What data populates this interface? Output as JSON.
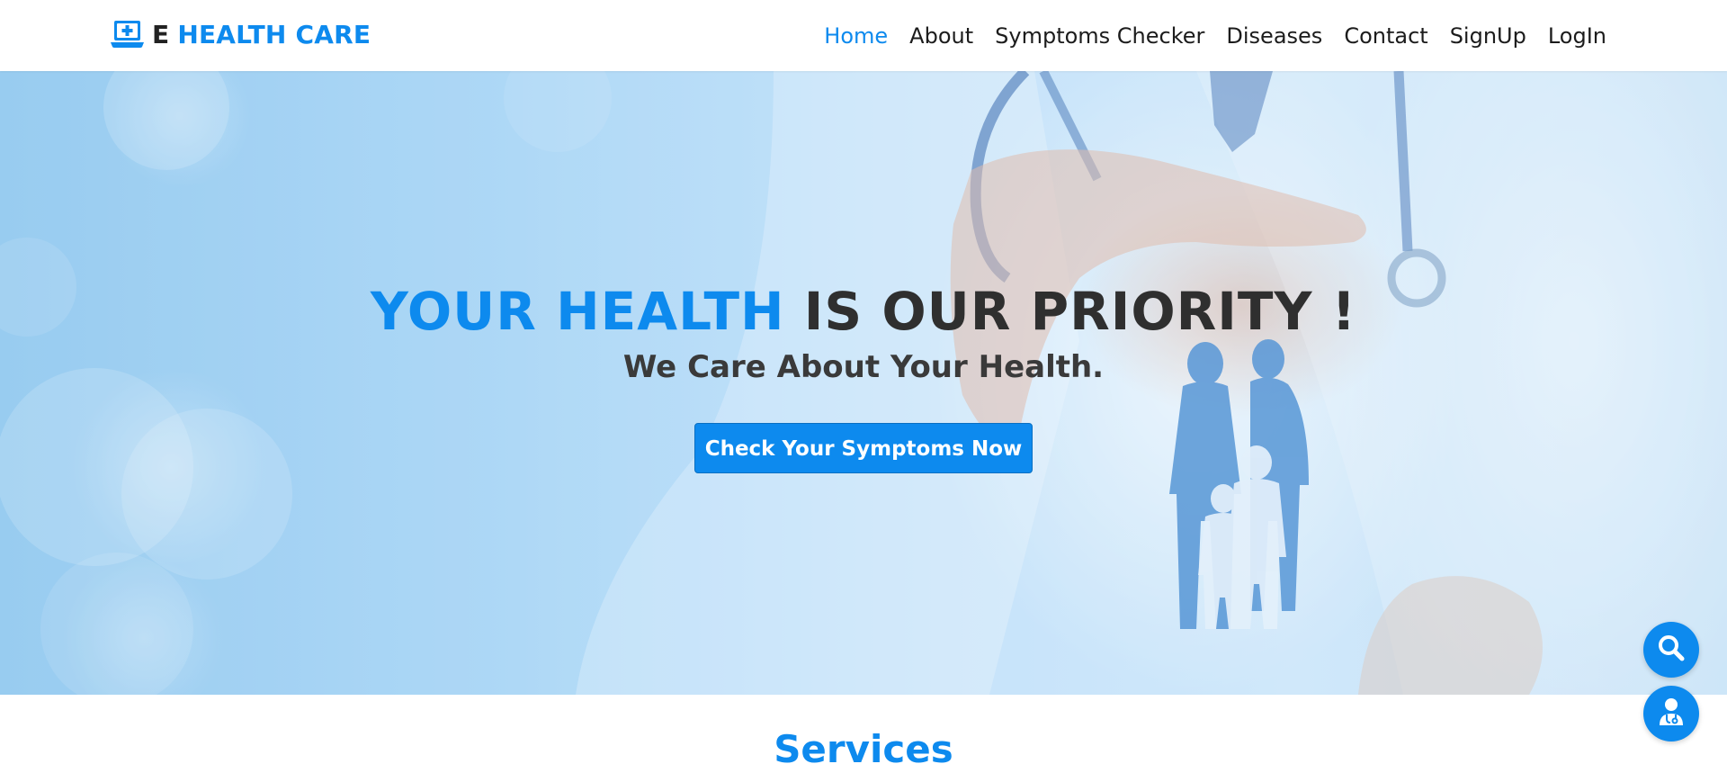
{
  "brand": {
    "prefix": "E",
    "name": "HEALTH CARE",
    "icon": "medical-laptop-icon"
  },
  "nav": {
    "items": [
      {
        "label": "Home",
        "active": true
      },
      {
        "label": "About",
        "active": false
      },
      {
        "label": "Symptoms Checker",
        "active": false
      },
      {
        "label": "Diseases",
        "active": false
      },
      {
        "label": "Contact",
        "active": false
      },
      {
        "label": "SignUp",
        "active": false
      },
      {
        "label": "LogIn",
        "active": false
      }
    ]
  },
  "hero": {
    "title_accent": "YOUR HEALTH",
    "title_rest": " IS OUR PRIORITY !",
    "subtitle": "We Care About Your Health.",
    "cta_label": "Check Your Symptoms Now",
    "background_image": "doctor-hand-protecting-family-silhouette"
  },
  "services": {
    "title": "Services"
  },
  "floating_buttons": [
    {
      "icon": "search-icon"
    },
    {
      "icon": "doctor-icon"
    }
  ],
  "colors": {
    "accent": "#0d8aee",
    "text_dark": "#2f2f2f",
    "nav_text": "#1c1c1c",
    "white": "#ffffff"
  }
}
